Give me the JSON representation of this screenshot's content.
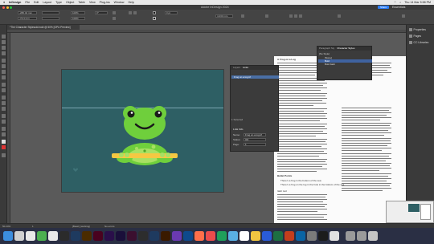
{
  "menubar": {
    "apple": "",
    "app_name": "InDesign",
    "items": [
      "File",
      "Edit",
      "Layout",
      "Type",
      "Object",
      "Table",
      "View",
      "Plug-ins",
      "Window",
      "Help"
    ],
    "clock": "Thu 14 Mar 5:58 PM"
  },
  "appbar": {
    "title": "Adobe InDesign 2024",
    "share_label": "Share",
    "workspace_label": "Essentials"
  },
  "controlbar": {
    "x_value": "-280.42 mm",
    "y_value": "-73.4 mm",
    "w_value": "",
    "h_value": "",
    "scale_x": "100%",
    "scale_y": "100%",
    "angle": "0°",
    "stroke": "0 pt",
    "width_value": "4.233 mm"
  },
  "document_tab": {
    "label": "*The Character Stylesold.indd @ 50% [GPU Preview]"
  },
  "layers_panel": {
    "tabs": [
      "Layers",
      "Links"
    ],
    "rows": [
      {
        "label": "Frog on a log.tif",
        "selected": true
      }
    ],
    "footer_count": "1 Selected",
    "link_info_label": "Link Info",
    "fields": [
      {
        "label": "Name:",
        "value": "Frog on a log.tif"
      },
      {
        "label": "Status:",
        "value": "OK"
      },
      {
        "label": "Page:",
        "value": "1"
      }
    ]
  },
  "character_panel": {
    "tabs": [
      "Paragraph Sty",
      "Character Styles"
    ],
    "header": "[No Style]",
    "rows": [
      {
        "label": "[None]",
        "selected": false
      },
      {
        "label": "Bold",
        "selected": true
      },
      {
        "label": "Bold Italic",
        "selected": false
      }
    ]
  },
  "text_page": {
    "paragraphs": [
      "A Frog on a Log",
      "Bullet Points",
      "There's a frog in the bottom of the sea",
      "There's a frog on the log in the hole in the bottom of the sea",
      "Italic text"
    ]
  },
  "right_panel": {
    "items": [
      {
        "label": "Properties",
        "icon": "properties-icon"
      },
      {
        "label": "Pages",
        "icon": "pages-icon"
      },
      {
        "label": "CC Libraries",
        "icon": "cc-libraries-icon"
      }
    ]
  },
  "statusbar": {
    "zoom": "50.24%",
    "page": "1",
    "preflight": "[Basic] (working)",
    "errors": "No errors"
  },
  "colors": {
    "page_background": "#2e5f64",
    "frog_green": "#6fcf3c",
    "selection_blue": "#4a6fa5",
    "share_blue": "#2d7ff9"
  }
}
